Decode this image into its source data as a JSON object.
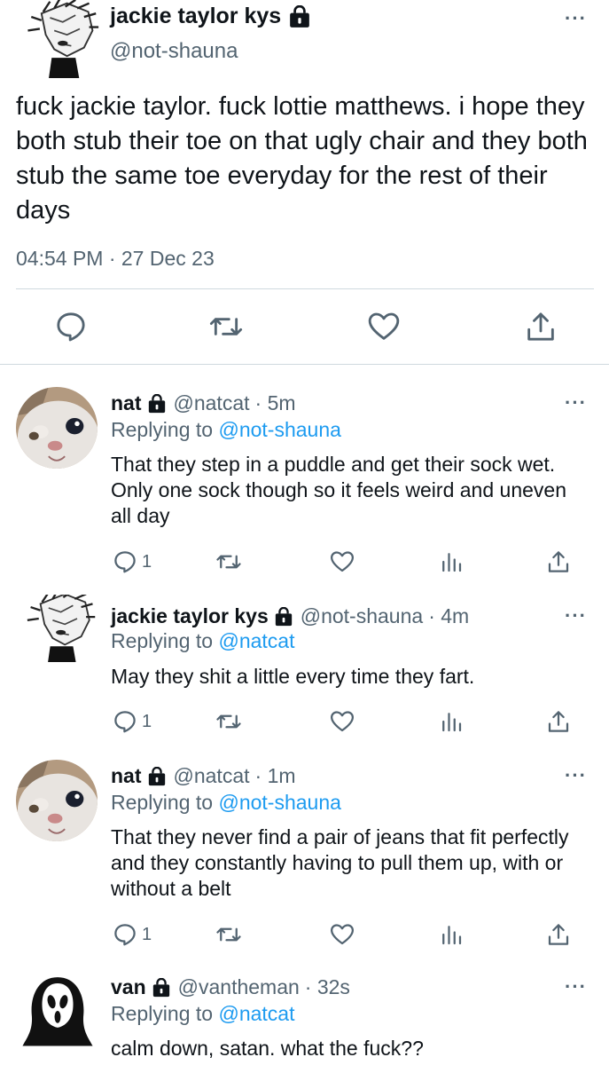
{
  "main_tweet": {
    "author_name": "jackie taylor kys",
    "author_handle": "@not-shauna",
    "text": "fuck jackie taylor. fuck lottie matthews. i hope they both stub their toe on that ugly chair and they both stub the same toe everyday for the rest of their days",
    "timestamp": "04:54 PM · 27 Dec 23",
    "more_icon": "more-dots-icon",
    "actions": [
      "reply-icon",
      "retweet-icon",
      "like-icon",
      "share-icon"
    ]
  },
  "replies": [
    {
      "name": "nat",
      "handle": "@natcat",
      "time": "· 5m",
      "replying_label": "Replying to",
      "replying_to": "@not-shauna",
      "text": "That they step in a puddle and get their sock wet. Only one sock though so it feels weird and uneven all day",
      "reply_count": "1",
      "avatar": "cat-avatar"
    },
    {
      "name": "jackie taylor kys",
      "handle": "@not-shauna",
      "time": "· 4m",
      "replying_label": "Replying to",
      "replying_to": "@natcat",
      "text": "May they shit a little every time they fart.",
      "reply_count": "1",
      "avatar": "sketch-avatar"
    },
    {
      "name": "nat",
      "handle": "@natcat",
      "time": "· 1m",
      "replying_label": "Replying to",
      "replying_to": "@not-shauna",
      "text": "That they never find a pair of jeans that fit perfectly and they constantly having to pull them up, with or without a belt",
      "reply_count": "1",
      "avatar": "cat-avatar"
    },
    {
      "name": "van",
      "handle": "@vantheman",
      "time": "· 32s",
      "replying_label": "Replying to",
      "replying_to": "@natcat",
      "text": "calm down, satan. what the fuck??",
      "avatar": "ghostface-avatar"
    }
  ],
  "colors": {
    "accent": "#1d9bf0",
    "muted": "#536471",
    "text": "#0f1419",
    "divider": "#cfd9de"
  }
}
